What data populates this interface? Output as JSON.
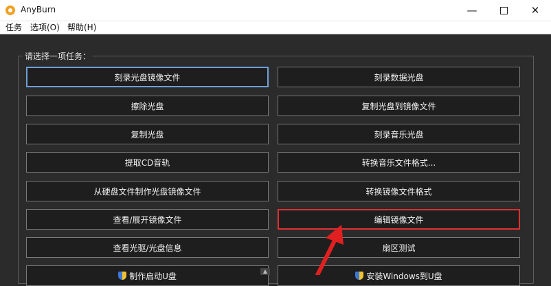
{
  "window": {
    "title": "AnyBurn",
    "minimize_glyph": "—",
    "close_glyph": "✕"
  },
  "menu": [
    "任务",
    "选项(O)",
    "帮助(H)"
  ],
  "task_group": {
    "label": "请选择一项任务：",
    "buttons": [
      {
        "label": "刻录光盘镜像文件",
        "column": "left",
        "row": 0,
        "state": "default"
      },
      {
        "label": "刻录数据光盘",
        "column": "right",
        "row": 0
      },
      {
        "label": "擦除光盘",
        "column": "left",
        "row": 1
      },
      {
        "label": "复制光盘到镜像文件",
        "column": "right",
        "row": 1
      },
      {
        "label": "复制光盘",
        "column": "left",
        "row": 2
      },
      {
        "label": "刻录音乐光盘",
        "column": "right",
        "row": 2
      },
      {
        "label": "提取CD音轨",
        "column": "left",
        "row": 3
      },
      {
        "label": "转换音乐文件格式...",
        "column": "right",
        "row": 3
      },
      {
        "label": "从硬盘文件制作光盘镜像文件",
        "column": "left",
        "row": 4
      },
      {
        "label": "转换镜像文件格式",
        "column": "right",
        "row": 4
      },
      {
        "label": "查看/展开镜像文件",
        "column": "left",
        "row": 5
      },
      {
        "label": "编辑镜像文件",
        "column": "right",
        "row": 5,
        "state": "highlighted"
      },
      {
        "label": "查看光驱/光盘信息",
        "column": "left",
        "row": 6
      },
      {
        "label": "扇区测试",
        "column": "right",
        "row": 6
      },
      {
        "label": "制作启动U盘",
        "column": "left",
        "row": 7,
        "icon": "shield-icon"
      },
      {
        "label": "安装Windows到U盘",
        "column": "right",
        "row": 7,
        "icon": "shield-icon"
      }
    ]
  },
  "annotation": {
    "type": "red-arrow",
    "points_to": "编辑镜像文件",
    "color": "#e02020"
  },
  "colors": {
    "background": "#2b2b2b",
    "button_bg": "#1e1e1e",
    "focus_border": "#6f9fd8",
    "highlight_border": "#e03030"
  }
}
